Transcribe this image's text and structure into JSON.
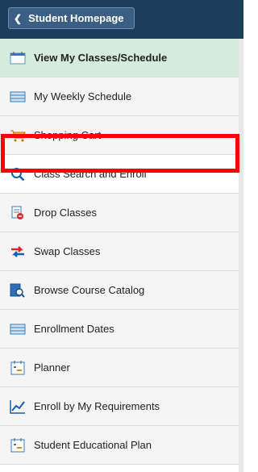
{
  "header": {
    "back_label": "Student Homepage"
  },
  "nav": {
    "items": [
      {
        "label": "View My Classes/Schedule",
        "icon": "calendar-icon",
        "active": true
      },
      {
        "label": "My Weekly Schedule",
        "icon": "weekly-schedule-icon"
      },
      {
        "label": "Shopping Cart",
        "icon": "shopping-cart-icon"
      },
      {
        "label": "Class Search and Enroll",
        "icon": "search-icon",
        "highlighted": true
      },
      {
        "label": "Drop Classes",
        "icon": "drop-icon"
      },
      {
        "label": "Swap Classes",
        "icon": "swap-icon"
      },
      {
        "label": "Browse Course Catalog",
        "icon": "catalog-icon"
      },
      {
        "label": "Enrollment Dates",
        "icon": "enrollment-dates-icon"
      },
      {
        "label": "Planner",
        "icon": "planner-icon"
      },
      {
        "label": "Enroll by My Requirements",
        "icon": "chart-icon"
      },
      {
        "label": "Student Educational Plan",
        "icon": "educational-plan-icon"
      }
    ]
  },
  "colors": {
    "header_bg": "#1c3e5c",
    "active_bg": "#d5ebdc",
    "highlight": "#ff0000"
  }
}
